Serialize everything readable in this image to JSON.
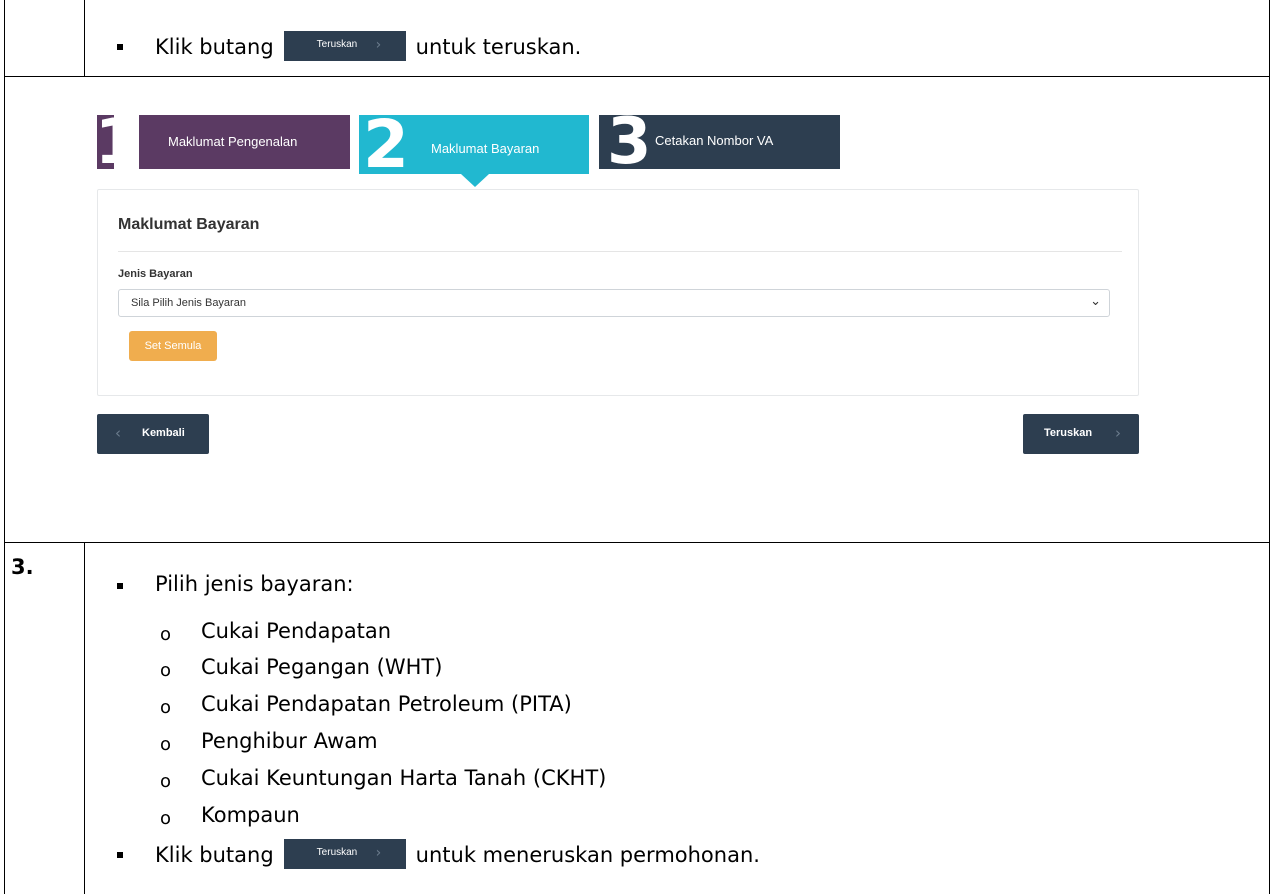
{
  "row1": {
    "instruction_before": "Klik butang",
    "inline_button_label": "Teruskan",
    "instruction_after": "untuk teruskan."
  },
  "wizard": {
    "steps": [
      {
        "number": "1",
        "label": "Maklumat Pengenalan",
        "color": "#5b3a63"
      },
      {
        "number": "2",
        "label": "Maklumat Bayaran",
        "color": "#21b8d0"
      },
      {
        "number": "3",
        "label": "Cetakan Nombor VA",
        "color": "#2d3e50"
      }
    ],
    "active_step": 2
  },
  "form": {
    "title": "Maklumat Bayaran",
    "field_label": "Jenis Bayaran",
    "select_value": "Sila Pilih Jenis Bayaran",
    "reset_label": "Set Semula"
  },
  "nav": {
    "back_label": "Kembali",
    "next_label": "Teruskan"
  },
  "step3": {
    "number": "3.",
    "intro": "Pilih jenis bayaran:",
    "options": [
      "Cukai Pendapatan",
      "Cukai Pegangan (WHT)",
      "Cukai Pendapatan Petroleum (PITA)",
      "Penghibur Awam",
      "Cukai Keuntungan Harta Tanah (CKHT)",
      "Kompaun"
    ],
    "instruction_before": "Klik butang",
    "inline_button_label": "Teruskan",
    "instruction_after": "untuk meneruskan permohonan."
  },
  "colors": {
    "dark_navy": "#2d3e50",
    "purple": "#5b3a63",
    "cyan": "#21b8d0",
    "orange": "#f0ad4e"
  }
}
